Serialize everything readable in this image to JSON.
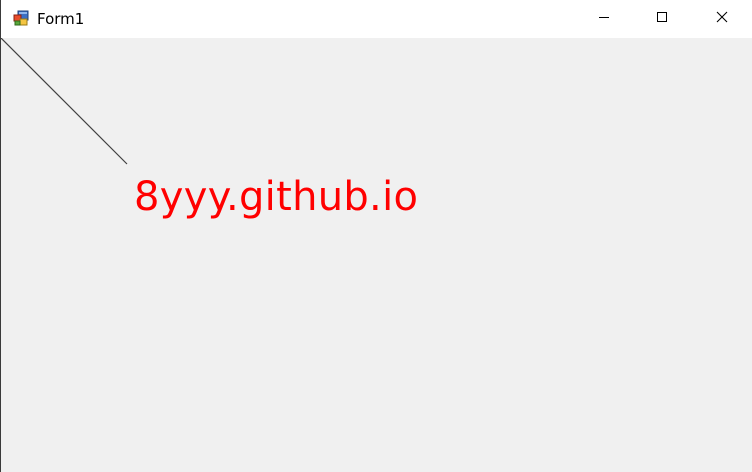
{
  "window": {
    "title": "Form1",
    "icon": "winforms-app-icon"
  },
  "caption_buttons": {
    "minimize_icon": "minimize-icon",
    "maximize_icon": "maximize-icon",
    "close_icon": "close-icon"
  },
  "canvas": {
    "text": "8yyy.github.io",
    "text_color": "#ff0000",
    "line_color": "#404040",
    "background": "#f0f0f0"
  }
}
